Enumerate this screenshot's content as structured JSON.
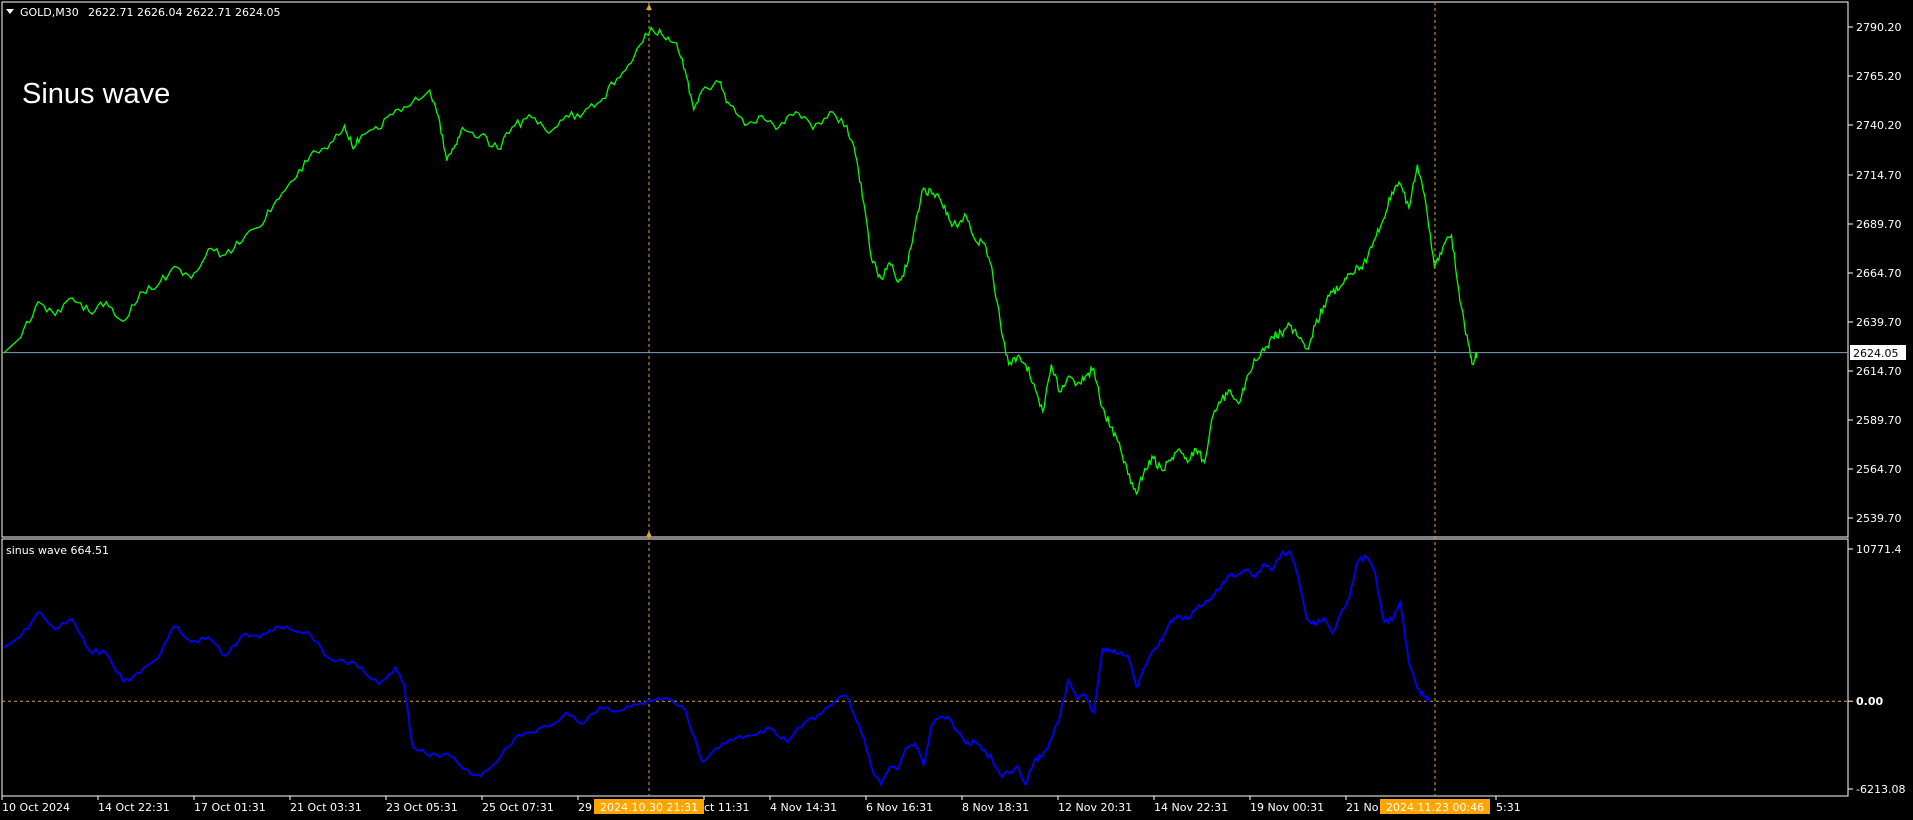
{
  "header": {
    "symbol": "GOLD,M30",
    "ohlc": "2622.71 2626.04 2622.71 2624.05",
    "chart_label": "Sinus wave"
  },
  "indicator": {
    "label": "sinus wave 664.51"
  },
  "colors": {
    "background": "#000000",
    "price_line": "#00ff00",
    "indicator_line": "#0000ff",
    "current_price_line": "#7f9fbf",
    "crosshair": "#d9a441",
    "highlight_label_bg": "#ffa500"
  },
  "current_price_tag": "2624.05",
  "x_ticks": [
    "10 Oct 2024",
    "14 Oct 22:31",
    "17 Oct 01:31",
    "21 Oct 03:31",
    "23 Oct 05:31",
    "25 Oct 07:31",
    "29",
    "ct 11:31",
    "4 Nov 14:31",
    "6 Nov 16:31",
    "8 Nov 18:31",
    "12 Nov 20:31",
    "14 Nov 22:31",
    "19 Nov 00:31",
    "21 No",
    "5:31"
  ],
  "x_highlights": [
    "2024.10.30 21:31",
    "2024.11.23 00:46"
  ],
  "chart_data": [
    {
      "type": "line",
      "title": "GOLD,M30",
      "series": [
        {
          "name": "GOLD,M30",
          "points": [
            [
              0,
              2624
            ],
            [
              4,
              2632
            ],
            [
              8,
              2650
            ],
            [
              12,
              2643
            ],
            [
              16,
              2652
            ],
            [
              20,
              2645
            ],
            [
              24,
              2650
            ],
            [
              28,
              2640
            ],
            [
              32,
              2655
            ],
            [
              36,
              2658
            ],
            [
              40,
              2668
            ],
            [
              44,
              2662
            ],
            [
              48,
              2677
            ],
            [
              52,
              2674
            ],
            [
              56,
              2681
            ],
            [
              60,
              2688
            ],
            [
              64,
              2702
            ],
            [
              68,
              2712
            ],
            [
              72,
              2725
            ],
            [
              76,
              2728
            ],
            [
              80,
              2740
            ],
            [
              82,
              2728
            ],
            [
              84,
              2735
            ],
            [
              88,
              2738
            ],
            [
              92,
              2748
            ],
            [
              96,
              2752
            ],
            [
              100,
              2758
            ],
            [
              102,
              2745
            ],
            [
              104,
              2722
            ],
            [
              106,
              2730
            ],
            [
              108,
              2738
            ],
            [
              112,
              2735
            ],
            [
              116,
              2728
            ],
            [
              120,
              2740
            ],
            [
              124,
              2744
            ],
            [
              128,
              2736
            ],
            [
              132,
              2745
            ],
            [
              136,
              2746
            ],
            [
              140,
              2752
            ],
            [
              144,
              2764
            ],
            [
              148,
              2775
            ],
            [
              152,
              2790
            ],
            [
              155,
              2785
            ],
            [
              158,
              2782
            ],
            [
              160,
              2768
            ],
            [
              162,
              2748
            ],
            [
              164,
              2758
            ],
            [
              168,
              2762
            ],
            [
              170,
              2752
            ],
            [
              174,
              2740
            ],
            [
              178,
              2745
            ],
            [
              182,
              2739
            ],
            [
              186,
              2747
            ],
            [
              190,
              2738
            ],
            [
              194,
              2747
            ],
            [
              198,
              2740
            ],
            [
              200,
              2725
            ],
            [
              202,
              2700
            ],
            [
              204,
              2670
            ],
            [
              206,
              2662
            ],
            [
              208,
              2670
            ],
            [
              210,
              2660
            ],
            [
              212,
              2668
            ],
            [
              214,
              2688
            ],
            [
              216,
              2708
            ],
            [
              218,
              2705
            ],
            [
              220,
              2702
            ],
            [
              222,
              2692
            ],
            [
              224,
              2688
            ],
            [
              226,
              2694
            ],
            [
              228,
              2682
            ],
            [
              230,
              2680
            ],
            [
              232,
              2668
            ],
            [
              234,
              2640
            ],
            [
              236,
              2618
            ],
            [
              238,
              2622
            ],
            [
              240,
              2618
            ],
            [
              242,
              2608
            ],
            [
              244,
              2594
            ],
            [
              246,
              2618
            ],
            [
              248,
              2604
            ],
            [
              250,
              2612
            ],
            [
              252,
              2608
            ],
            [
              254,
              2612
            ],
            [
              256,
              2616
            ],
            [
              258,
              2596
            ],
            [
              260,
              2586
            ],
            [
              262,
              2578
            ],
            [
              264,
              2562
            ],
            [
              266,
              2552
            ],
            [
              268,
              2565
            ],
            [
              270,
              2570
            ],
            [
              272,
              2564
            ],
            [
              274,
              2569
            ],
            [
              276,
              2575
            ],
            [
              278,
              2568
            ],
            [
              280,
              2575
            ],
            [
              282,
              2568
            ],
            [
              284,
              2592
            ],
            [
              286,
              2600
            ],
            [
              288,
              2605
            ],
            [
              290,
              2598
            ],
            [
              292,
              2612
            ],
            [
              294,
              2620
            ],
            [
              296,
              2625
            ],
            [
              298,
              2632
            ],
            [
              300,
              2634
            ],
            [
              302,
              2638
            ],
            [
              304,
              2632
            ],
            [
              306,
              2626
            ],
            [
              308,
              2638
            ],
            [
              310,
              2648
            ],
            [
              312,
              2655
            ],
            [
              314,
              2658
            ],
            [
              316,
              2664
            ],
            [
              318,
              2668
            ],
            [
              320,
              2670
            ],
            [
              322,
              2682
            ],
            [
              324,
              2692
            ],
            [
              326,
              2706
            ],
            [
              328,
              2710
            ],
            [
              330,
              2698
            ],
            [
              332,
              2720
            ],
            [
              334,
              2700
            ],
            [
              336,
              2668
            ],
            [
              338,
              2678
            ],
            [
              340,
              2684
            ],
            [
              342,
              2650
            ],
            [
              344,
              2628
            ],
            [
              345,
              2618
            ],
            [
              346,
              2624
            ]
          ]
        }
      ],
      "ylim": [
        2530,
        2800
      ],
      "yticks": [
        2790.2,
        2765.2,
        2740.2,
        2714.7,
        2689.7,
        2664.7,
        2639.7,
        2614.7,
        2589.7,
        2564.7,
        2539.7
      ],
      "ytick_labels": [
        "2790.20",
        "2765.20",
        "2740.20",
        "2714.70",
        "2689.70",
        "2664.70",
        "2639.70",
        "2614.70",
        "2589.70",
        "2564.70",
        "2539.70"
      ],
      "current_value": 2624.05
    },
    {
      "type": "line",
      "title": "sinus wave 664.51",
      "series": [
        {
          "name": "sinus wave",
          "points": [
            [
              0,
              3800
            ],
            [
              4,
              4600
            ],
            [
              8,
              6300
            ],
            [
              12,
              5100
            ],
            [
              16,
              5800
            ],
            [
              20,
              3600
            ],
            [
              24,
              3400
            ],
            [
              28,
              1400
            ],
            [
              32,
              2000
            ],
            [
              36,
              3000
            ],
            [
              40,
              5300
            ],
            [
              44,
              4200
            ],
            [
              48,
              4500
            ],
            [
              52,
              3200
            ],
            [
              56,
              4700
            ],
            [
              60,
              4500
            ],
            [
              64,
              5300
            ],
            [
              68,
              5000
            ],
            [
              72,
              4700
            ],
            [
              76,
              3100
            ],
            [
              80,
              2800
            ],
            [
              84,
              2400
            ],
            [
              88,
              1200
            ],
            [
              92,
              2400
            ],
            [
              94,
              1200
            ],
            [
              96,
              -3200
            ],
            [
              100,
              -3900
            ],
            [
              104,
              -3700
            ],
            [
              108,
              -4800
            ],
            [
              112,
              -5300
            ],
            [
              116,
              -4200
            ],
            [
              120,
              -2600
            ],
            [
              124,
              -2200
            ],
            [
              128,
              -1800
            ],
            [
              132,
              -800
            ],
            [
              136,
              -1600
            ],
            [
              140,
              -400
            ],
            [
              144,
              -700
            ],
            [
              148,
              -200
            ],
            [
              152,
              0
            ],
            [
              156,
              200
            ],
            [
              160,
              -600
            ],
            [
              164,
              -4300
            ],
            [
              168,
              -3300
            ],
            [
              172,
              -2600
            ],
            [
              176,
              -2400
            ],
            [
              180,
              -1900
            ],
            [
              184,
              -2900
            ],
            [
              188,
              -1500
            ],
            [
              192,
              -900
            ],
            [
              196,
              200
            ],
            [
              198,
              300
            ],
            [
              200,
              -1200
            ],
            [
              202,
              -2600
            ],
            [
              204,
              -4900
            ],
            [
              206,
              -5900
            ],
            [
              208,
              -4700
            ],
            [
              210,
              -4800
            ],
            [
              212,
              -3300
            ],
            [
              214,
              -3000
            ],
            [
              216,
              -4500
            ],
            [
              218,
              -1600
            ],
            [
              220,
              -1100
            ],
            [
              222,
              -1200
            ],
            [
              224,
              -2200
            ],
            [
              226,
              -3000
            ],
            [
              228,
              -2900
            ],
            [
              230,
              -3500
            ],
            [
              232,
              -4000
            ],
            [
              234,
              -5200
            ],
            [
              236,
              -5100
            ],
            [
              238,
              -4600
            ],
            [
              240,
              -5900
            ],
            [
              242,
              -4200
            ],
            [
              244,
              -3800
            ],
            [
              246,
              -2700
            ],
            [
              248,
              -1100
            ],
            [
              250,
              1500
            ],
            [
              252,
              200
            ],
            [
              254,
              500
            ],
            [
              256,
              -800
            ],
            [
              258,
              3700
            ],
            [
              260,
              3600
            ],
            [
              262,
              3400
            ],
            [
              264,
              3200
            ],
            [
              266,
              1000
            ],
            [
              268,
              2400
            ],
            [
              270,
              3600
            ],
            [
              272,
              4300
            ],
            [
              274,
              5700
            ],
            [
              276,
              6000
            ],
            [
              278,
              5800
            ],
            [
              280,
              6500
            ],
            [
              282,
              6900
            ],
            [
              284,
              7500
            ],
            [
              286,
              8200
            ],
            [
              288,
              8900
            ],
            [
              290,
              9000
            ],
            [
              292,
              9300
            ],
            [
              294,
              8800
            ],
            [
              296,
              9700
            ],
            [
              298,
              9300
            ],
            [
              300,
              10400
            ],
            [
              302,
              10600
            ],
            [
              304,
              8800
            ],
            [
              306,
              5900
            ],
            [
              308,
              5400
            ],
            [
              310,
              5900
            ],
            [
              312,
              4800
            ],
            [
              314,
              6200
            ],
            [
              316,
              7300
            ],
            [
              318,
              9900
            ],
            [
              320,
              10200
            ],
            [
              322,
              9200
            ],
            [
              324,
              5800
            ],
            [
              326,
              5700
            ],
            [
              328,
              7000
            ],
            [
              330,
              2700
            ],
            [
              332,
              900
            ],
            [
              334,
              300
            ],
            [
              335,
              0
            ]
          ]
        }
      ],
      "ylim": [
        -6600,
        11400
      ],
      "yticks": [
        10771.4,
        0.0,
        -6213.08
      ],
      "ytick_labels": [
        "10771.4",
        "0.00",
        "-6213.08"
      ],
      "zero_line": 0
    }
  ]
}
